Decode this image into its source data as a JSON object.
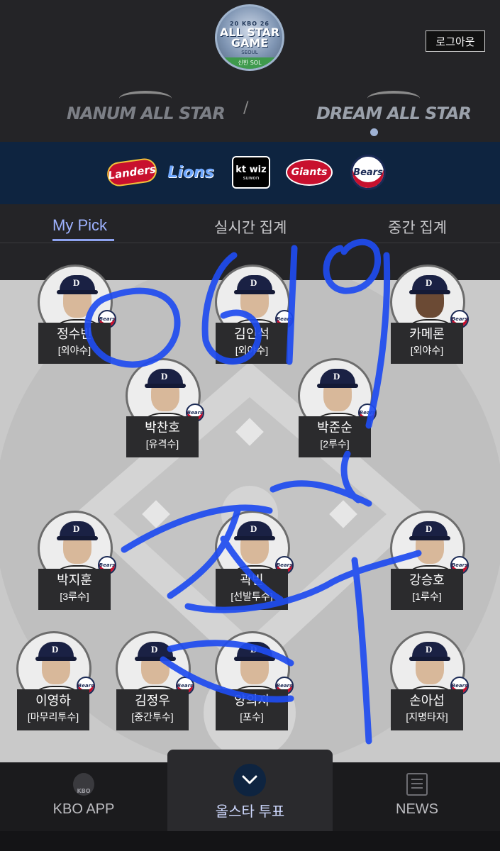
{
  "header": {
    "logo": {
      "top_text": "20 KBO 26",
      "main_text": "ALL STAR GAME",
      "city": "SEOUL",
      "sponsor": "신한 SOL"
    },
    "logout_label": "로그아웃",
    "leagues": [
      {
        "label": "NANUM ALL STAR",
        "active": false
      },
      {
        "label": "DREAM ALL STAR",
        "active": true
      }
    ],
    "league_separator": "/"
  },
  "teams": [
    {
      "name": "SSG Landers",
      "text": "Landers"
    },
    {
      "name": "Samsung Lions",
      "text": "Lions"
    },
    {
      "name": "kt wiz",
      "text": "kt wiz",
      "sub": "suwon"
    },
    {
      "name": "Lotte Giants",
      "text": "Giants"
    },
    {
      "name": "Doosan Bears",
      "text": "Bears"
    }
  ],
  "subtabs": [
    {
      "label": "My Pick",
      "active": true
    },
    {
      "label": "실시간 집계",
      "active": false
    },
    {
      "label": "중간 집계",
      "active": false
    }
  ],
  "players": [
    {
      "name": "정수빈",
      "position": "[외야수]",
      "team_badge": "Bears"
    },
    {
      "name": "김인석",
      "position": "[외야수]",
      "team_badge": "Bears"
    },
    {
      "name": "카메론",
      "position": "[외야수]",
      "team_badge": "Bears"
    },
    {
      "name": "박찬호",
      "position": "[유격수]",
      "team_badge": "Bears"
    },
    {
      "name": "박준순",
      "position": "[2루수]",
      "team_badge": "Bears"
    },
    {
      "name": "박지훈",
      "position": "[3루수]",
      "team_badge": "Bears"
    },
    {
      "name": "곽빈",
      "position": "[선발투수]",
      "team_badge": "Bears"
    },
    {
      "name": "강승호",
      "position": "[1루수]",
      "team_badge": "Bears"
    },
    {
      "name": "이영하",
      "position": "[마무리투수]",
      "team_badge": "Bears"
    },
    {
      "name": "김정우",
      "position": "[중간투수]",
      "team_badge": "Bears"
    },
    {
      "name": "양의지",
      "position": "[포수]",
      "team_badge": "Bears"
    },
    {
      "name": "손아섭",
      "position": "[지명타자]",
      "team_badge": "Bears"
    }
  ],
  "bottom_nav": {
    "kbo_app": {
      "label": "KBO APP",
      "icon_text": "KBO"
    },
    "vote": {
      "label": "올스타 투표"
    },
    "news": {
      "label": "NEWS"
    }
  },
  "colors": {
    "accent": "#9eb2ff",
    "team_bar": "#0e2440",
    "scribble": "#1f4cf0"
  }
}
